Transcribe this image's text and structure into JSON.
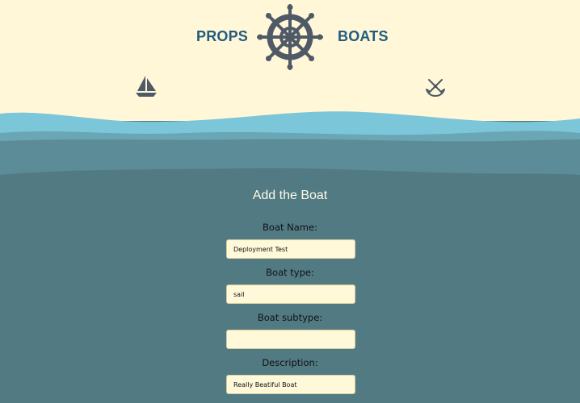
{
  "header": {
    "brand_left": "PROPS",
    "brand_right": "BOATS",
    "logo_icon": "ship-wheel-icon",
    "left_icon": "sailboat-icon",
    "right_icon": "anchor-icon"
  },
  "form": {
    "title": "Add the Boat",
    "fields": [
      {
        "label": "Boat Name:",
        "value": "Deployment Test"
      },
      {
        "label": "Boat type:",
        "value": "sail"
      },
      {
        "label": "Boat subtype:",
        "value": ""
      },
      {
        "label": "Description:",
        "value": "Really Beatiful Boat"
      }
    ]
  },
  "colors": {
    "header_bg": "#fff7d8",
    "brand_text": "#225c7e",
    "wave_light": "#78c3d8",
    "wave_mid": "#5d8f99",
    "sea": "#517a83",
    "icon": "#4e5a66",
    "title_text": "#fffbe7",
    "input_bg": "#fff9d9"
  }
}
